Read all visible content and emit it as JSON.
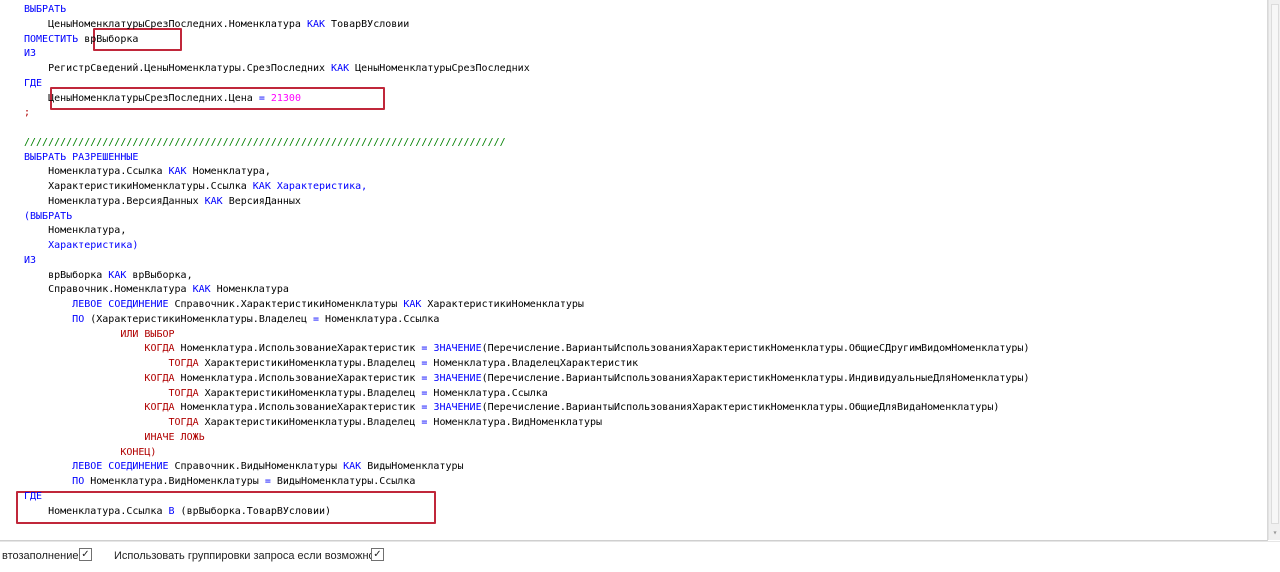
{
  "lines": [
    [
      {
        "t": "ВЫБРАТЬ",
        "c": "kw"
      }
    ],
    [
      {
        "t": "    ЦеныНоменклатурыСрезПоследних.Номенклатура ",
        "c": "id"
      },
      {
        "t": "КАК",
        "c": "kw"
      },
      {
        "t": " ТоварВУсловии",
        "c": "id"
      }
    ],
    [
      {
        "t": "ПОМЕСТИТЬ",
        "c": "kw"
      },
      {
        "t": " врВыборка",
        "c": "id"
      }
    ],
    [
      {
        "t": "ИЗ",
        "c": "kw"
      }
    ],
    [
      {
        "t": "    РегистрСведений.ЦеныНоменклатуры.СрезПоследних ",
        "c": "id"
      },
      {
        "t": "КАК",
        "c": "kw"
      },
      {
        "t": " ЦеныНоменклатурыСрезПоследних",
        "c": "id"
      }
    ],
    [
      {
        "t": "ГДЕ",
        "c": "kw"
      }
    ],
    [
      {
        "t": "    ЦеныНоменклатурыСрезПоследних.Цена ",
        "c": "id"
      },
      {
        "t": "=",
        "c": "kw"
      },
      {
        "t": " 21300",
        "c": "num"
      }
    ],
    [
      {
        "t": ";",
        "c": "kw2"
      }
    ],
    [],
    [
      {
        "t": "////////////////////////////////////////////////////////////////////////////////",
        "c": "cm"
      }
    ],
    [
      {
        "t": "ВЫБРАТЬ РАЗРЕШЕННЫЕ",
        "c": "kw"
      }
    ],
    [
      {
        "t": "    Номенклатура.Ссылка ",
        "c": "id"
      },
      {
        "t": "КАК",
        "c": "kw"
      },
      {
        "t": " Номенклатура,",
        "c": "id"
      }
    ],
    [
      {
        "t": "    ХарактеристикиНоменклатуры.Ссылка ",
        "c": "id"
      },
      {
        "t": "КАК",
        "c": "kw"
      },
      {
        "t": " Характеристика,",
        "c": "kw"
      }
    ],
    [
      {
        "t": "    Номенклатура.ВерсияДанных ",
        "c": "id"
      },
      {
        "t": "КАК",
        "c": "kw"
      },
      {
        "t": " ВерсияДанных",
        "c": "id"
      }
    ],
    [
      {
        "t": "(ВЫБРАТЬ",
        "c": "kw"
      }
    ],
    [
      {
        "t": "    Номенклатура,",
        "c": "id"
      }
    ],
    [
      {
        "t": "    Характеристика)",
        "c": "kw"
      }
    ],
    [
      {
        "t": "ИЗ",
        "c": "kw"
      }
    ],
    [
      {
        "t": "    врВыборка ",
        "c": "id"
      },
      {
        "t": "КАК",
        "c": "kw"
      },
      {
        "t": " врВыборка,",
        "c": "id"
      }
    ],
    [
      {
        "t": "    Справочник.Номенклатура ",
        "c": "id"
      },
      {
        "t": "КАК",
        "c": "kw"
      },
      {
        "t": " Номенклатура",
        "c": "id"
      }
    ],
    [
      {
        "t": "        ",
        "c": "id"
      },
      {
        "t": "ЛЕВОЕ СОЕДИНЕНИЕ",
        "c": "kw"
      },
      {
        "t": " Справочник.ХарактеристикиНоменклатуры ",
        "c": "id"
      },
      {
        "t": "КАК",
        "c": "kw"
      },
      {
        "t": " ХарактеристикиНоменклатуры",
        "c": "id"
      }
    ],
    [
      {
        "t": "        ",
        "c": "id"
      },
      {
        "t": "ПО",
        "c": "kw"
      },
      {
        "t": " (ХарактеристикиНоменклатуры.Владелец ",
        "c": "id"
      },
      {
        "t": "=",
        "c": "kw"
      },
      {
        "t": " Номенклатура.Ссылка",
        "c": "id"
      }
    ],
    [
      {
        "t": "                ",
        "c": "id"
      },
      {
        "t": "ИЛИ ВЫБОР",
        "c": "kw2"
      }
    ],
    [
      {
        "t": "                    ",
        "c": "id"
      },
      {
        "t": "КОГДА",
        "c": "kw2"
      },
      {
        "t": " Номенклатура.ИспользованиеХарактеристик ",
        "c": "id"
      },
      {
        "t": "=",
        "c": "kw"
      },
      {
        "t": " ",
        "c": "id"
      },
      {
        "t": "ЗНАЧЕНИЕ",
        "c": "kw"
      },
      {
        "t": "(Перечисление.ВариантыИспользованияХарактеристикНоменклатуры.ОбщиеСДругимВидомНоменклатуры)",
        "c": "id"
      }
    ],
    [
      {
        "t": "                        ",
        "c": "id"
      },
      {
        "t": "ТОГДА",
        "c": "kw2"
      },
      {
        "t": " ХарактеристикиНоменклатуры.Владелец ",
        "c": "id"
      },
      {
        "t": "=",
        "c": "kw"
      },
      {
        "t": " Номенклатура.ВладелецХарактеристик",
        "c": "id"
      }
    ],
    [
      {
        "t": "                    ",
        "c": "id"
      },
      {
        "t": "КОГДА",
        "c": "kw2"
      },
      {
        "t": " Номенклатура.ИспользованиеХарактеристик ",
        "c": "id"
      },
      {
        "t": "=",
        "c": "kw"
      },
      {
        "t": " ",
        "c": "id"
      },
      {
        "t": "ЗНАЧЕНИЕ",
        "c": "kw"
      },
      {
        "t": "(Перечисление.ВариантыИспользованияХарактеристикНоменклатуры.ИндивидуальныеДляНоменклатуры)",
        "c": "id"
      }
    ],
    [
      {
        "t": "                        ",
        "c": "id"
      },
      {
        "t": "ТОГДА",
        "c": "kw2"
      },
      {
        "t": " ХарактеристикиНоменклатуры.Владелец ",
        "c": "id"
      },
      {
        "t": "=",
        "c": "kw"
      },
      {
        "t": " Номенклатура.Ссылка",
        "c": "id"
      }
    ],
    [
      {
        "t": "                    ",
        "c": "id"
      },
      {
        "t": "КОГДА",
        "c": "kw2"
      },
      {
        "t": " Номенклатура.ИспользованиеХарактеристик ",
        "c": "id"
      },
      {
        "t": "=",
        "c": "kw"
      },
      {
        "t": " ",
        "c": "id"
      },
      {
        "t": "ЗНАЧЕНИЕ",
        "c": "kw"
      },
      {
        "t": "(Перечисление.ВариантыИспользованияХарактеристикНоменклатуры.ОбщиеДляВидаНоменклатуры)",
        "c": "id"
      }
    ],
    [
      {
        "t": "                        ",
        "c": "id"
      },
      {
        "t": "ТОГДА",
        "c": "kw2"
      },
      {
        "t": " ХарактеристикиНоменклатуры.Владелец ",
        "c": "id"
      },
      {
        "t": "=",
        "c": "kw"
      },
      {
        "t": " Номенклатура.ВидНоменклатуры",
        "c": "id"
      }
    ],
    [
      {
        "t": "                    ",
        "c": "id"
      },
      {
        "t": "ИНАЧЕ ЛОЖЬ",
        "c": "kw2"
      }
    ],
    [
      {
        "t": "                ",
        "c": "id"
      },
      {
        "t": "КОНЕЦ)",
        "c": "kw2"
      }
    ],
    [
      {
        "t": "        ",
        "c": "id"
      },
      {
        "t": "ЛЕВОЕ СОЕДИНЕНИЕ",
        "c": "kw"
      },
      {
        "t": " Справочник.ВидыНоменклатуры ",
        "c": "id"
      },
      {
        "t": "КАК",
        "c": "kw"
      },
      {
        "t": " ВидыНоменклатуры",
        "c": "id"
      }
    ],
    [
      {
        "t": "        ",
        "c": "id"
      },
      {
        "t": "ПО",
        "c": "kw"
      },
      {
        "t": " Номенклатура.ВидНоменклатуры ",
        "c": "id"
      },
      {
        "t": "=",
        "c": "kw"
      },
      {
        "t": " ВидыНоменклатуры.Ссылка",
        "c": "id"
      }
    ],
    [
      {
        "t": "ГДЕ",
        "c": "kw"
      }
    ],
    [
      {
        "t": "    Номенклатура.Ссылка ",
        "c": "id"
      },
      {
        "t": "В",
        "c": "kw"
      },
      {
        "t": " (врВыборка.ТоварВУсловии)",
        "c": "id"
      }
    ]
  ],
  "bottom": {
    "autofill_label": "втозаполнение",
    "autofill_checked": true,
    "grouping_label": "Использовать группировки запроса если возможно",
    "grouping_checked": true
  },
  "colors": {
    "keyword": "#0000ff",
    "keyword2": "#b00000",
    "comment": "#008000",
    "number": "#ff00ff",
    "highlight": "#c0273a"
  },
  "icons": {
    "checkmark": "check-icon"
  }
}
